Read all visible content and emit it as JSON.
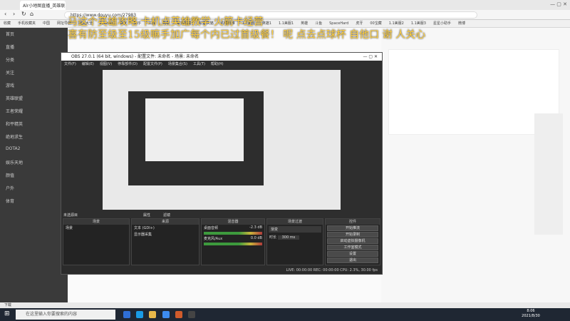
{
  "browser": {
    "tab_title": "Alr小地图直播_英雄联...",
    "url": "https://www.douyu.com/27983",
    "bookmarks": [
      "收藏",
      "手机收藏夹",
      "中国",
      "网址导航",
      "网页大全",
      "Lenovo",
      "百度",
      "知乎",
      "工具",
      "电视",
      "京东商城",
      "淘宝·天猫",
      "购物日推",
      "1.1美服",
      "英雄1",
      "1.1美服1",
      "英雄",
      "斗鱼",
      "SpaceHard",
      "虎牙",
      "00宝藏",
      "1.1美服2",
      "1.1美服3",
      "星星小助手",
      "微博"
    ]
  },
  "overlay_text": {
    "line1": "马这个英雄攻略 卡机点英雄教学 火箭卡经营",
    "line2": "喜有防至级至15级嘛手加广每个内已过首级餐！ 呢 点去点球杯 自他口 谢 人关心"
  },
  "left_nav": {
    "items": [
      "首页",
      "直播",
      "分类",
      "关注",
      "游戏",
      "英雄联盟",
      "王者荣耀",
      "和平精英",
      "绝地求生",
      "DOTA2",
      "娱乐天地",
      "颜值",
      "户外",
      "体育"
    ]
  },
  "obs": {
    "title": "OBS 27.0.1 (64 bit, windows) - 配置文件: 未命名 - 场景: 未命名",
    "menu": [
      "文件(F)",
      "编辑(E)",
      "视图(V)",
      "停靠部件(D)",
      "配置文件(P)",
      "场景集合(S)",
      "工具(T)",
      "帮助(H)"
    ],
    "no_source_label": "未选源目",
    "properties_btn": "属性",
    "filters_btn": "滤镜",
    "panels": {
      "scenes": "场景",
      "sources": "来源",
      "mixer": "混音器",
      "transitions": "场景过渡",
      "controls": "控件"
    },
    "scene_items": [
      "场景"
    ],
    "source_items": [
      "文本 (GDI+)",
      "显示器采集"
    ],
    "mixer_items": [
      "桌面音频",
      "麦克风/Aux"
    ],
    "mixer_db": [
      "-2.3 dB",
      "0.0 dB"
    ],
    "transition_type": "渐变",
    "duration_label": "时长",
    "duration_value": "300 ms",
    "controls": [
      "开始推流",
      "开始录制",
      "启动虚拟摄像机",
      "工作室模式",
      "设置",
      "退出"
    ],
    "status": "LIVE: 00:00:00   REC: 00:00:00   CPU: 2.3%, 30.00 fps"
  },
  "download_strip": "下载",
  "taskbar": {
    "search_placeholder": "在这里输入你要搜索的内容",
    "time": "8:06",
    "date": "2021/8/30"
  }
}
